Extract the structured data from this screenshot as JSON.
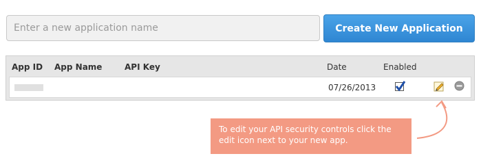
{
  "app_name_input": {
    "placeholder": "Enter a new application name",
    "value": ""
  },
  "create_button": {
    "label": "Create New Application"
  },
  "table": {
    "headers": {
      "app_id": "App ID",
      "app_name": "App Name",
      "api_key": "API Key",
      "date": "Date",
      "enabled": "Enabled"
    },
    "rows": [
      {
        "app_id": "",
        "app_name": "",
        "api_key": "",
        "date": "07/26/2013",
        "enabled": true
      }
    ]
  },
  "tooltip": {
    "text": "To edit your API security controls click the edit icon next to your new app."
  },
  "colors": {
    "button": "#2f86d2",
    "tooltip": "#f39a83",
    "table_header": "#e6e6e6"
  },
  "icons": {
    "edit": "pencil-icon",
    "remove": "remove-icon",
    "enabled": "checkbox-icon"
  }
}
